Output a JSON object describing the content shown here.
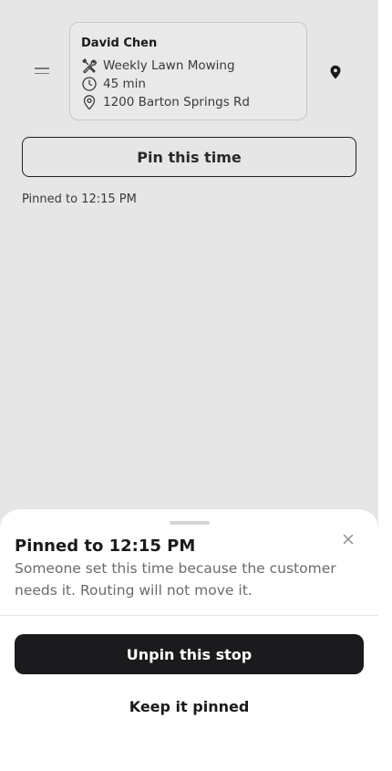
{
  "stop": {
    "customer_name": "David Chen",
    "service": "Weekly Lawn Mowing",
    "duration": "45 min",
    "address": "1200 Barton Springs Rd"
  },
  "icons": {
    "drag": "drag-handle-icon",
    "service": "tools-icon",
    "duration": "clock-icon",
    "address": "location-pin-icon",
    "map": "map-pin-icon",
    "close": "close-icon"
  },
  "actions": {
    "pin_label": "Pin this time",
    "pinned_note": "Pinned to 12:15 PM"
  },
  "sheet": {
    "title": "Pinned to 12:15 PM",
    "body": "Someone set this time because the customer needs it. Routing will not move it.",
    "primary_label": "Unpin this stop",
    "secondary_label": "Keep it pinned"
  },
  "colors": {
    "backdrop": "#e6e6e6",
    "primary_button": "#1b1b1d",
    "secondary_text": "#6b6b6b"
  }
}
